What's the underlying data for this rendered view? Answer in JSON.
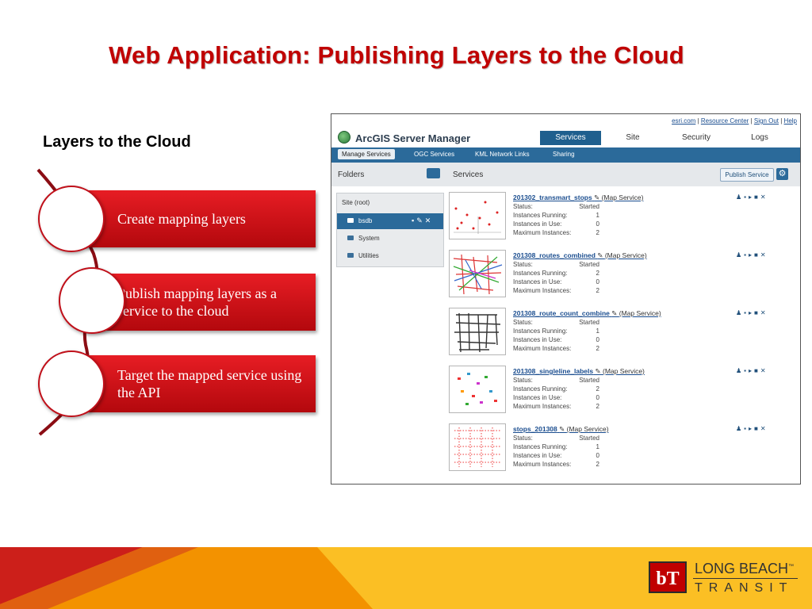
{
  "slide": {
    "title": "Web Application: Publishing Layers to the Cloud",
    "subtitle": "Layers to the Cloud"
  },
  "steps": [
    {
      "label": "Create mapping layers"
    },
    {
      "label": "Publish mapping layers as a service to the cloud"
    },
    {
      "label": "Target the mapped service using the API"
    }
  ],
  "colors": {
    "accent": "#c00000",
    "step_bar": "#d11018",
    "footer_red": "#cc1f1a",
    "footer_orange": "#f39200",
    "footer_yellow": "#fbbf24",
    "nav_blue": "#2b6a9a"
  },
  "manager": {
    "top_links": [
      "esri.com",
      "Resource Center",
      "Sign Out",
      "Help"
    ],
    "app_title": "ArcGIS Server Manager",
    "nav": [
      "Services",
      "Site",
      "Security",
      "Logs"
    ],
    "nav_selected": "Services",
    "subnav": [
      "Manage Services",
      "OGC Services",
      "KML Network Links",
      "Sharing"
    ],
    "subnav_selected": "Manage Services",
    "folders_label": "Folders",
    "services_label": "Services",
    "publish_button": "Publish Service",
    "folders": {
      "root": "Site (root)",
      "items": [
        "bsdb",
        "System",
        "Utilities"
      ],
      "selected": "bsdb"
    },
    "field_labels": [
      "Status:",
      "Instances Running:",
      "Instances in Use:",
      "Maximum Instances:"
    ],
    "services": [
      {
        "name": "201302_transmart_stops",
        "type": "(Map Service)",
        "status": "Started",
        "running": "1",
        "in_use": "0",
        "max": "2"
      },
      {
        "name": "201308_routes_combined",
        "type": "(Map Service)",
        "status": "Started",
        "running": "2",
        "in_use": "0",
        "max": "2"
      },
      {
        "name": "201308_route_count_combine",
        "type": "(Map Service)",
        "status": "Started",
        "running": "1",
        "in_use": "0",
        "max": "2"
      },
      {
        "name": "201308_singleline_labels",
        "type": "(Map Service)",
        "status": "Started",
        "running": "2",
        "in_use": "0",
        "max": "2"
      },
      {
        "name": "stops_201308",
        "type": "(Map Service)",
        "status": "Started",
        "running": "1",
        "in_use": "0",
        "max": "2"
      }
    ]
  },
  "footer": {
    "logo_mark": "bT",
    "logo_line1": "LONG BEACH",
    "logo_tm": "™",
    "logo_line2": "TRANSIT"
  }
}
